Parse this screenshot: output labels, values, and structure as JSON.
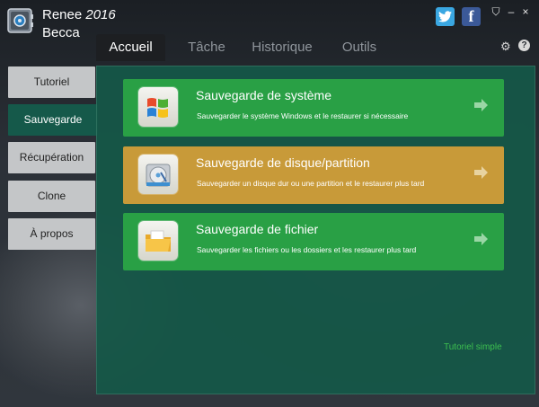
{
  "app": {
    "name": "Renee",
    "year": "2016",
    "subtitle": "Becca"
  },
  "window": {
    "buttons": {
      "minimize": "–",
      "close": "×",
      "skin": "⛉"
    }
  },
  "social": {
    "twitter_label": "t",
    "facebook_label": "f"
  },
  "tabs": [
    {
      "label": "Accueil",
      "active": true
    },
    {
      "label": "Tâche"
    },
    {
      "label": "Historique"
    },
    {
      "label": "Outils"
    }
  ],
  "toolbar": {
    "settings_icon": "gear-icon",
    "help_label": "?"
  },
  "sidebar": {
    "items": [
      {
        "label": "Tutoriel"
      },
      {
        "label": "Sauvegarde",
        "active": true
      },
      {
        "label": "Récupération"
      },
      {
        "label": "Clone"
      },
      {
        "label": "À propos"
      }
    ]
  },
  "cards": [
    {
      "title": "Sauvegarde de système",
      "description": "Sauvegarder le système Windows et le restaurer si nécessaire",
      "color": "#29a045",
      "icon": "windows-icon"
    },
    {
      "title": "Sauvegarde de disque/partition",
      "description": "Sauvegarder un disque dur ou une partition et le restaurer plus tard",
      "color": "#c89a39",
      "icon": "hard-disk-icon"
    },
    {
      "title": "Sauvegarde de fichier",
      "description": "Sauvegarder les fichiers ou les dossiers et les restaurer plus tard",
      "color": "#29a045",
      "icon": "folder-icon"
    }
  ],
  "footer_link": "Tutoriel simple",
  "colors": {
    "panel": "#155848",
    "card_green": "#29a045",
    "card_gold": "#c89a39",
    "link": "#3cbf4f"
  }
}
